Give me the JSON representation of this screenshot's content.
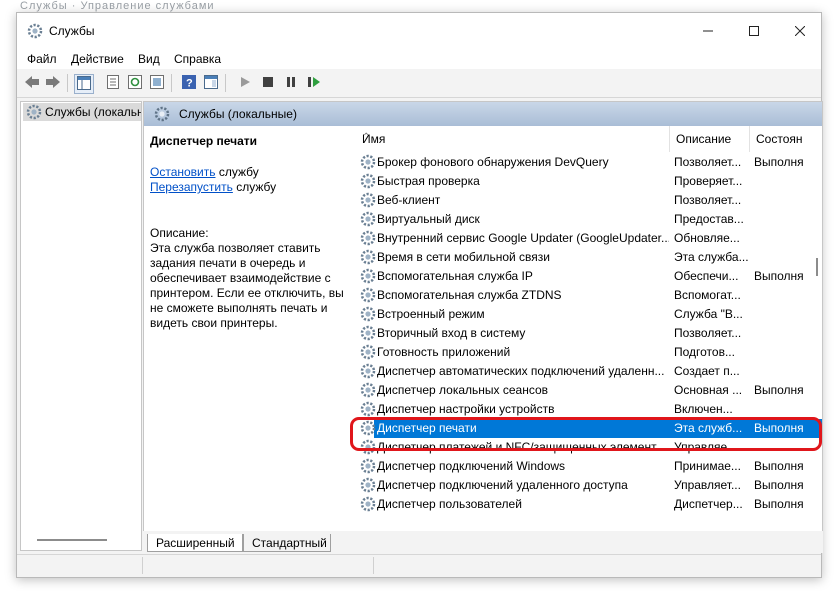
{
  "ghost_title": "Службы · Управление службами",
  "window": {
    "title": "Службы",
    "app_icon": "gear-icon"
  },
  "menu": [
    "Файл",
    "Действие",
    "Вид",
    "Справка"
  ],
  "toolbar": [
    "back-arrow-icon",
    "forward-arrow-icon",
    "console-tree-icon",
    "properties-icon",
    "refresh-icon",
    "export-list-icon",
    "help-icon",
    "show-pane-icon",
    "play-icon",
    "stop-icon",
    "pause-icon",
    "restart-icon"
  ],
  "tree": {
    "item": "Службы (локальные)"
  },
  "panel": {
    "header": "Службы (локальные)"
  },
  "details": {
    "service_name": "Диспетчер печати",
    "stop_link": "Остановить",
    "stop_suffix": " службу",
    "restart_link": "Перезапустить",
    "restart_suffix": " службу",
    "desc_label": "Описание:",
    "desc_text": "Эта служба позволяет ставить задания печати в очередь и обеспечивает взаимодействие с принтером.  Если ее отключить, вы не сможете выполнять печать и видеть свои принтеры."
  },
  "columns": {
    "name": "Имя",
    "description": "Описание",
    "status": "Состоян"
  },
  "services": [
    {
      "name": "Брокер фонового обнаружения DevQuery",
      "desc": "Позволяет...",
      "status": "Выполня"
    },
    {
      "name": "Быстрая проверка",
      "desc": "Проверяет...",
      "status": ""
    },
    {
      "name": "Веб-клиент",
      "desc": "Позволяет...",
      "status": ""
    },
    {
      "name": "Виртуальный диск",
      "desc": "Предостав...",
      "status": ""
    },
    {
      "name": "Внутренний сервис Google Updater (GoogleUpdater...",
      "desc": "Обновляе...",
      "status": ""
    },
    {
      "name": "Время в сети мобильной связи",
      "desc": "Эта служба...",
      "status": ""
    },
    {
      "name": "Вспомогательная служба IP",
      "desc": "Обеспечи...",
      "status": "Выполня"
    },
    {
      "name": "Вспомогательная служба ZTDNS",
      "desc": "Вспомогат...",
      "status": ""
    },
    {
      "name": "Встроенный режим",
      "desc": "Служба \"В...",
      "status": ""
    },
    {
      "name": "Вторичный вход в систему",
      "desc": "Позволяет...",
      "status": ""
    },
    {
      "name": "Готовность приложений",
      "desc": "Подготов...",
      "status": ""
    },
    {
      "name": "Диспетчер автоматических подключений удаленн...",
      "desc": "Создает п...",
      "status": ""
    },
    {
      "name": "Диспетчер локальных сеансов",
      "desc": "Основная ...",
      "status": "Выполня"
    },
    {
      "name": "Диспетчер настройки устройств",
      "desc": "Включен...",
      "status": ""
    },
    {
      "name": "Диспетчер печати",
      "desc": "Эта служб...",
      "status": "Выполня",
      "selected": true
    },
    {
      "name": "Диспетчер платежей и NFC/защищенных элемент...",
      "desc": "Управляе...",
      "status": ""
    },
    {
      "name": "Диспетчер подключений Windows",
      "desc": "Принимае...",
      "status": "Выполня"
    },
    {
      "name": "Диспетчер подключений удаленного доступа",
      "desc": "Управляет...",
      "status": "Выполня"
    },
    {
      "name": "Диспетчер пользователей",
      "desc": "Диспетчер...",
      "status": "Выполня"
    }
  ],
  "tabs": {
    "extended": "Расширенный",
    "standard": "Стандартный"
  },
  "colors": {
    "selection": "#0078d7",
    "highlight": "#e0161b",
    "link": "#0050c8"
  }
}
